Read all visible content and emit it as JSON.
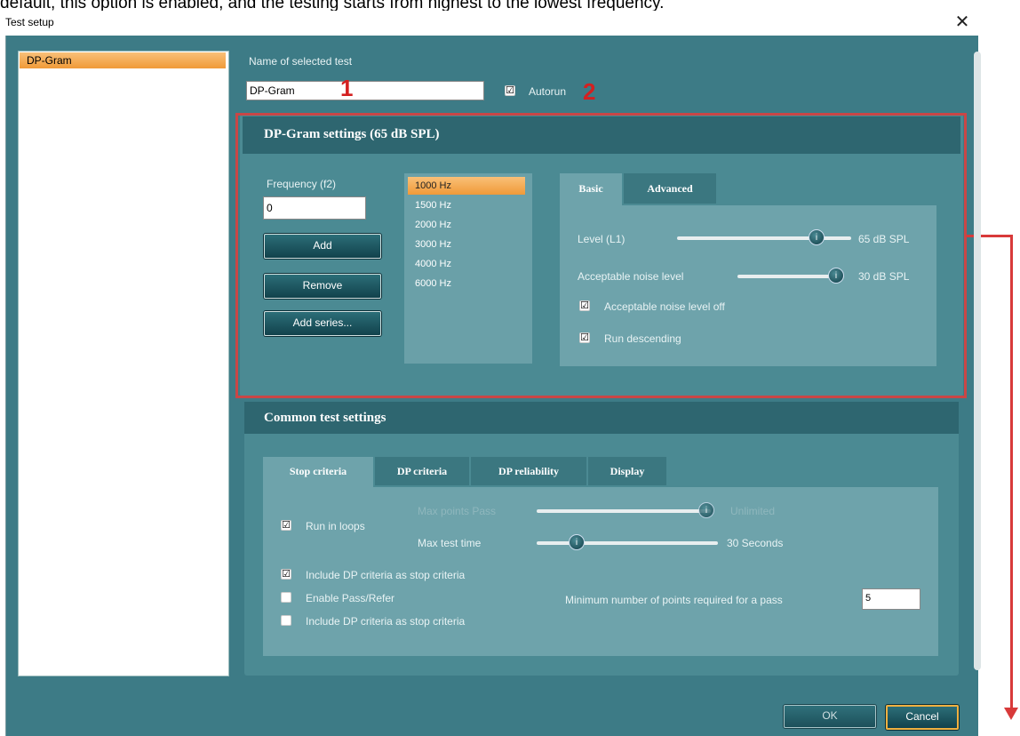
{
  "caption": "default, this option is enabled, and the testing starts from highest to the lowest frequency.",
  "window": {
    "title": "Test setup",
    "close": "✕"
  },
  "left_list": {
    "selected": "DP-Gram"
  },
  "test_name": {
    "label": "Name of selected test",
    "value": "DP-Gram",
    "autorun_label": "Autorun",
    "autorun_checked": "☑",
    "marker1": "1",
    "marker2": "2"
  },
  "dpgram": {
    "title": "DP-Gram settings (65 dB SPL)",
    "freq_label": "Frequency (f2)",
    "freq_value": "0",
    "buttons": {
      "add": "Add",
      "remove": "Remove",
      "add_series": "Add series..."
    },
    "frequencies": [
      "1000 Hz",
      "1500 Hz",
      "2000 Hz",
      "3000 Hz",
      "4000 Hz",
      "6000 Hz"
    ],
    "tabs": {
      "basic": "Basic",
      "advanced": "Advanced"
    },
    "level_label": "Level (L1)",
    "level_value": "65 dB SPL",
    "noise_label": "Acceptable noise level",
    "noise_value": "30 dB SPL",
    "noise_off_label": "Acceptable noise level off",
    "run_desc_label": "Run descending",
    "knob": "i"
  },
  "common": {
    "title": "Common test settings",
    "tabs": {
      "stop": "Stop criteria",
      "dp": "DP criteria",
      "rel": "DP reliability",
      "disp": "Display"
    },
    "run_loops": "Run in loops",
    "max_points_label": "Max points Pass",
    "max_points_value": "Unlimited",
    "max_time_label": "Max test time",
    "max_time_value": "30 Seconds",
    "incl_dp_1": "Include DP criteria as stop criteria",
    "enable_pass": "Enable Pass/Refer",
    "incl_dp_2": "Include DP criteria as stop criteria",
    "min_points_label": "Minimum number of points required for a pass",
    "min_points_value": "5"
  },
  "footer": {
    "ok": "OK",
    "cancel": "Cancel"
  },
  "colors": {
    "accent": "#f09a38",
    "background": "#3d7b86",
    "highlight": "#c94646"
  }
}
